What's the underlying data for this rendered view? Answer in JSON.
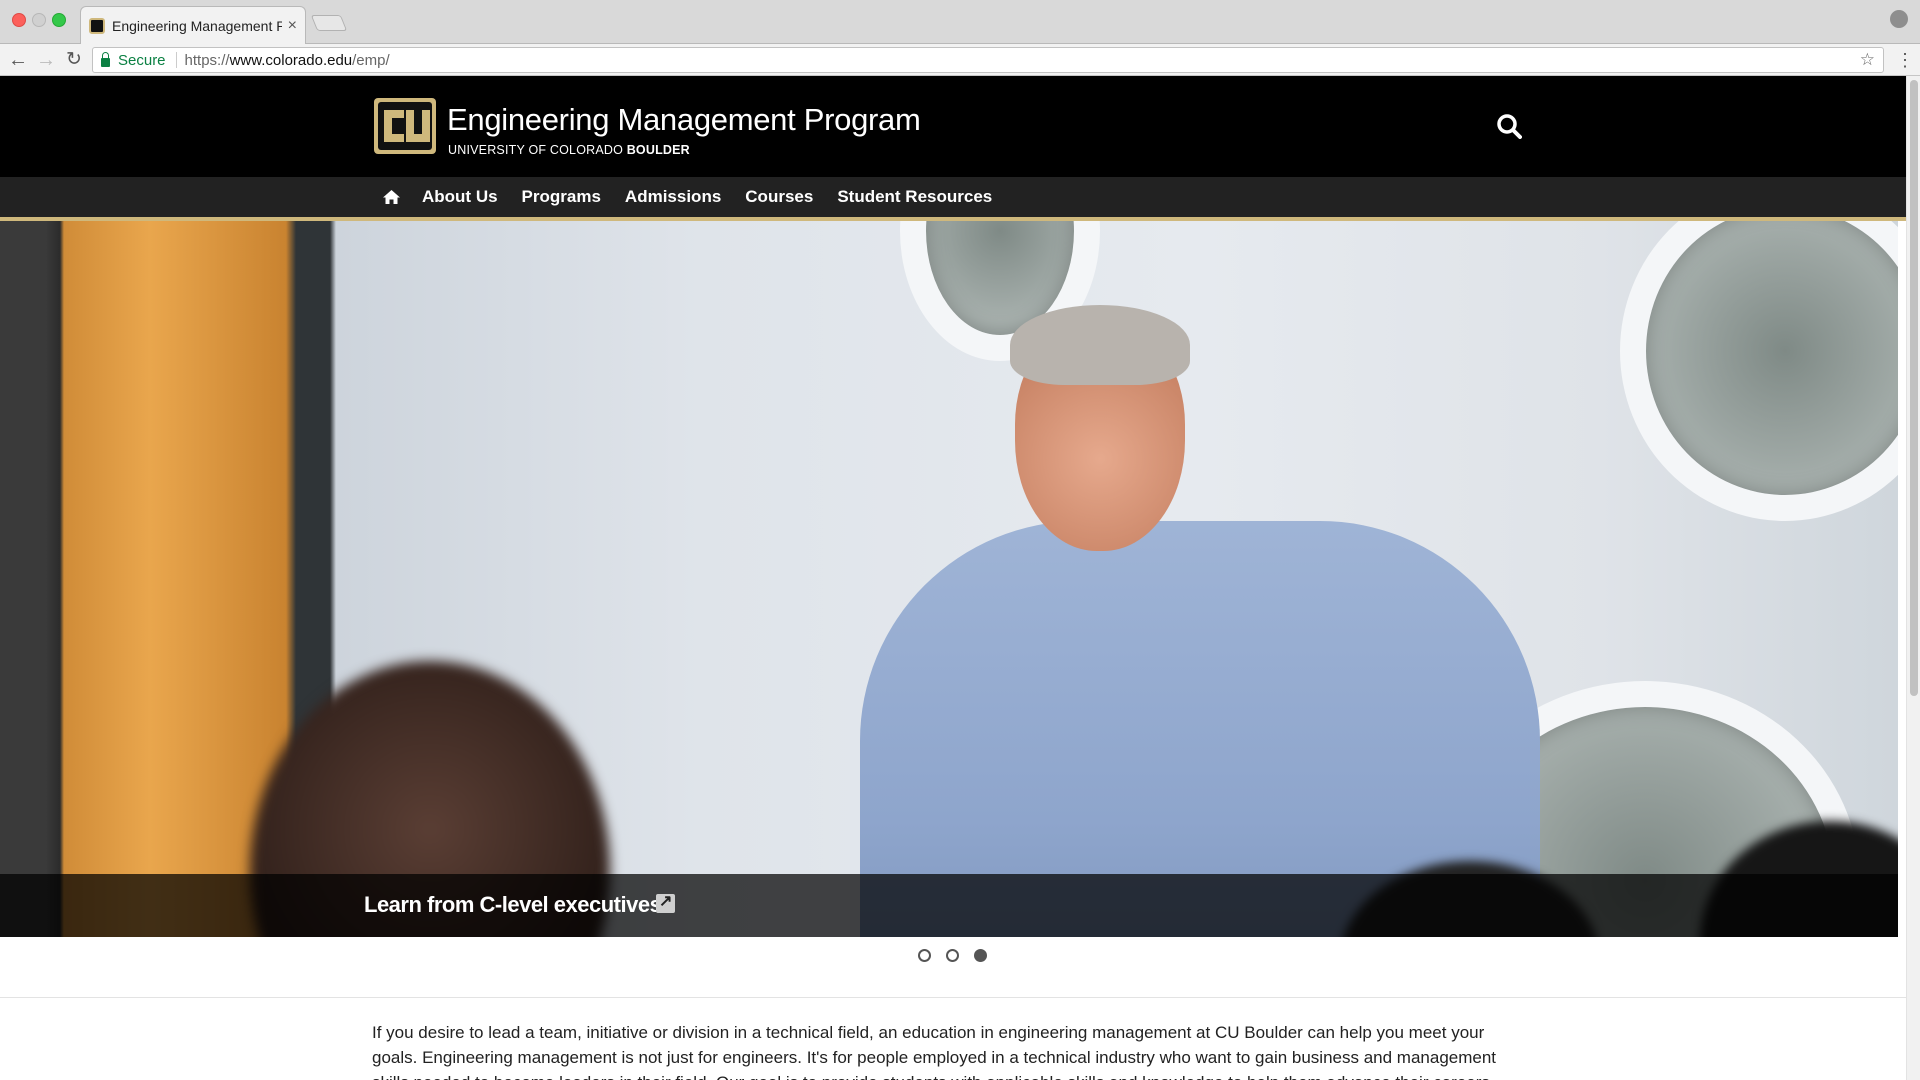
{
  "browser": {
    "tab_title": "Engineering Management Prog",
    "tab_close": "×",
    "secure_label": "Secure",
    "url_scheme": "https://",
    "url_host": "www.colorado.edu",
    "url_path": "/emp/",
    "back_glyph": "←",
    "forward_glyph": "→",
    "reload_glyph": "↻",
    "star_glyph": "☆",
    "menu_glyph": "⋮"
  },
  "header": {
    "site_title": "Engineering Management Program",
    "university_prefix": "UNIVERSITY OF COLORADO ",
    "university_bold": "BOULDER",
    "logo_icon": "cu-logo",
    "search_icon": "search-icon"
  },
  "nav": {
    "home_icon": "home-icon",
    "items": [
      {
        "label": "About Us"
      },
      {
        "label": "Programs"
      },
      {
        "label": "Admissions"
      },
      {
        "label": "Courses"
      },
      {
        "label": "Student Resources"
      }
    ]
  },
  "hero": {
    "caption": "Learn from C-level executives.",
    "link_icon": "external-link-icon",
    "slides": 3,
    "active_slide": 3
  },
  "intro": {
    "text": "If you desire to lead a team, initiative or division in a technical field, an education in engineering management at CU Boulder can help you meet your goals. Engineering management is not just for engineers. It's for people employed in a technical industry who want to gain business and management skills needed to become leaders in their field. Our goal is to provide students with applicable skills and knowledge to help them advance their careers."
  },
  "colors": {
    "brand_black": "#000000",
    "nav_background": "#222222",
    "gold_accent": "#cfb87c",
    "secure_green": "#0b8043"
  }
}
